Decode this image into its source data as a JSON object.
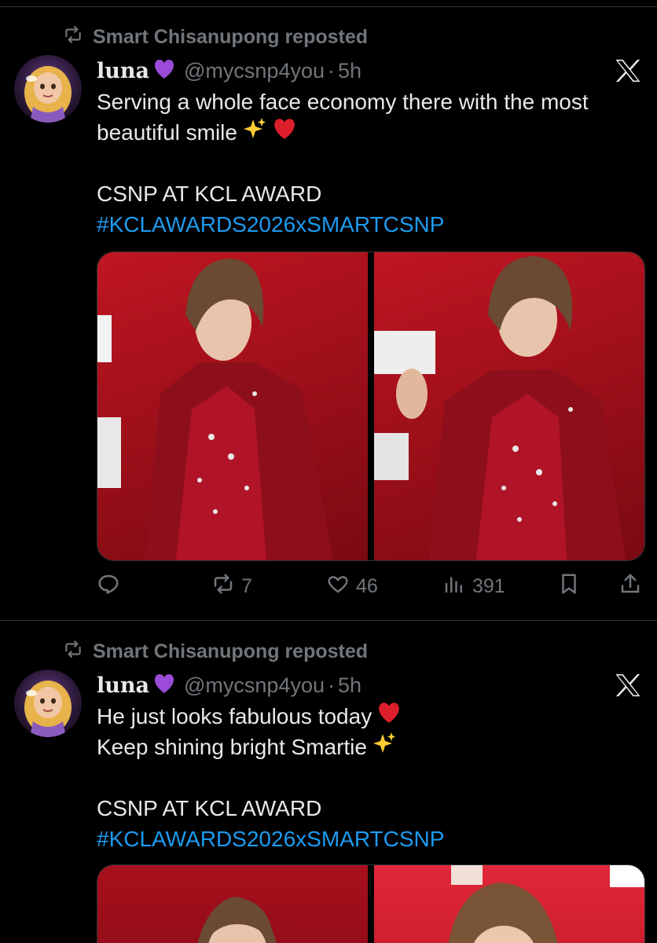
{
  "tweets": [
    {
      "repost_label": "Smart Chisanupong reposted",
      "display_name": "luna",
      "handle": "@mycsnp4you",
      "separator": "·",
      "time": "5h",
      "text_lines": [
        "Serving a whole face economy there with the most",
        "beautiful smile",
        "",
        "CSNP AT KCL AWARD"
      ],
      "hashtag": "#KCLAWARDS2026xSMARTCSNP",
      "stats": {
        "retweets": "7",
        "likes": "46",
        "views": "391"
      }
    },
    {
      "repost_label": "Smart Chisanupong reposted",
      "display_name": "luna",
      "handle": "@mycsnp4you",
      "separator": "·",
      "time": "5h",
      "text_lines": [
        "He just looks fabulous today",
        "Keep shining bright Smartie",
        "",
        "CSNP AT KCL AWARD"
      ],
      "hashtag": "#KCLAWARDS2026xSMARTCSNP"
    }
  ],
  "icons": {
    "repost": "repost-icon",
    "x_logo": "x-logo-icon",
    "reply": "reply-icon",
    "retweet": "retweet-icon",
    "like": "heart-icon",
    "views": "views-icon",
    "bookmark": "bookmark-icon",
    "share": "share-icon",
    "purple_heart": "purple-heart-emoji",
    "red_heart": "red-heart-emoji",
    "sparkles": "sparkles-emoji"
  },
  "colors": {
    "background": "#000000",
    "text": "#e7e9ea",
    "muted": "#71767b",
    "link": "#1d9bf0",
    "divider": "#2f3336",
    "photo_red": "#b3121d"
  }
}
